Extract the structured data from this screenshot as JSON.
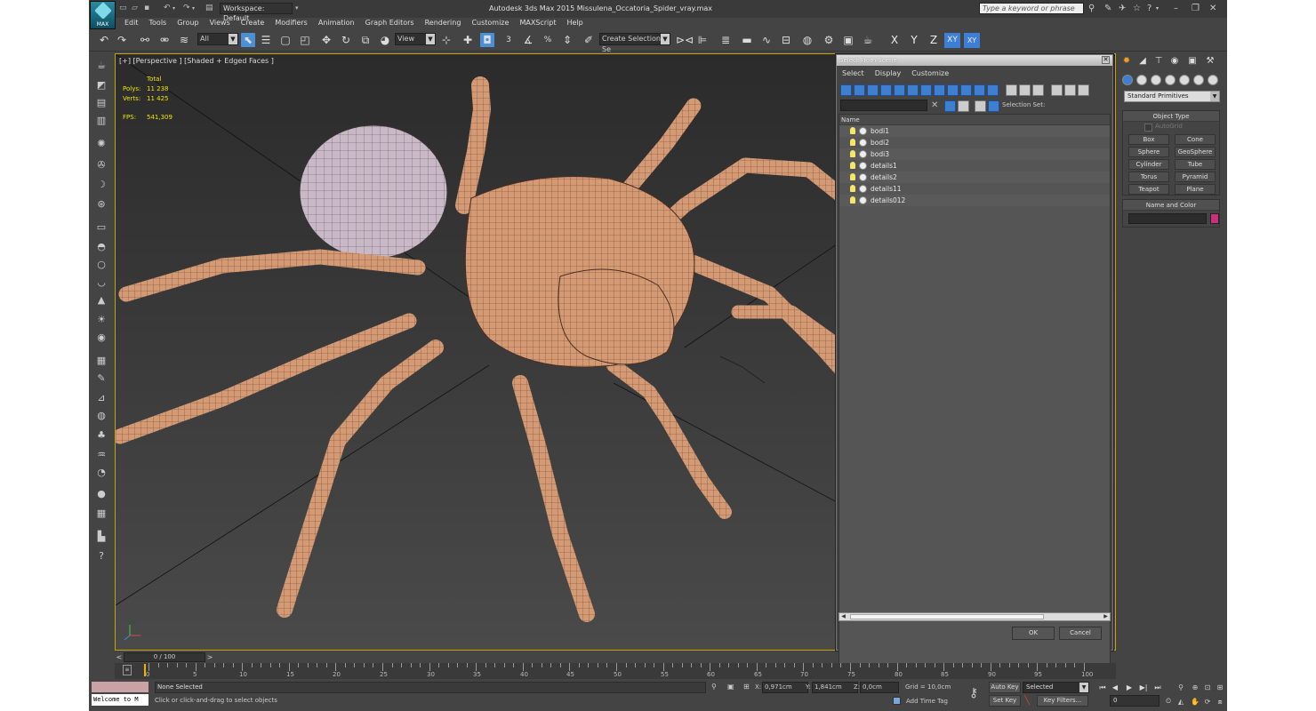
{
  "title_bar": {
    "app_logo": "MAX",
    "workspace": "Workspace: Default",
    "window_title": "Autodesk 3ds Max  2015     Missulena_Occatoria_Spider_vray.max",
    "search_placeholder": "Type a keyword or phrase"
  },
  "menu": [
    "Edit",
    "Tools",
    "Group",
    "Views",
    "Create",
    "Modifiers",
    "Animation",
    "Graph Editors",
    "Rendering",
    "Customize",
    "MAXScript",
    "Help"
  ],
  "toolbar": {
    "selection_filter": "All",
    "ref_coord": "View",
    "snap_label": "3",
    "selection_set_placeholder": "Create Selection Se",
    "axes": [
      "X",
      "Y",
      "Z",
      "XY",
      "XY"
    ]
  },
  "viewport": {
    "label": "[+] [Perspective ] [Shaded + Edged Faces ]",
    "stats_header": "Total",
    "polys_label": "Polys:",
    "polys_value": "11 238",
    "verts_label": "Verts:",
    "verts_value": "11 425",
    "fps_label": "FPS:",
    "fps_value": "541,309"
  },
  "select_from_scene": {
    "title": "Select From Scene",
    "menu": [
      "Select",
      "Display",
      "Customize"
    ],
    "selection_set_label": "Selection Set:",
    "column_name": "Name",
    "objects": [
      "bodi1",
      "bodi2",
      "bodi3",
      "details1",
      "details2",
      "details11",
      "details012"
    ],
    "ok": "OK",
    "cancel": "Cancel"
  },
  "command_panel": {
    "category": "Standard Primitives",
    "object_type_title": "Object Type",
    "autogrid": "AutoGrid",
    "primitives": [
      "Box",
      "Cone",
      "Sphere",
      "GeoSphere",
      "Cylinder",
      "Tube",
      "Torus",
      "Pyramid",
      "Teapot",
      "Plane"
    ],
    "name_color_title": "Name and Color",
    "object_color": "#c8307a"
  },
  "timeline": {
    "slider": "0 / 100",
    "ticks": [
      "0",
      "5",
      "10",
      "15",
      "20",
      "25",
      "30",
      "35",
      "40",
      "45",
      "50",
      "55",
      "60",
      "65",
      "70",
      "75",
      "80",
      "85",
      "90",
      "95",
      "100"
    ]
  },
  "status": {
    "listener_output": "Welcome to M",
    "selection": "None Selected",
    "prompt": "Click or click-and-drag to select objects",
    "x_label": "X:",
    "x_value": "0,971cm",
    "y_label": "Y:",
    "y_value": "1,841cm",
    "z_label": "Z:",
    "z_value": "0,0cm",
    "grid": "Grid = 10,0cm",
    "add_time_tag": "Add Time Tag",
    "auto_key": "Auto Key",
    "set_key": "Set Key",
    "key_mode": "Selected",
    "key_filters": "Key Filters...",
    "frame": "0"
  },
  "colors": {
    "spider_body": "#d49a74",
    "abdomen": "#c9b8c6",
    "mesh_wire": "#5a3a2a",
    "viewport_border": "#c8a400",
    "stats_text": "#f2e600",
    "active_axis": "#3d7fd6"
  }
}
